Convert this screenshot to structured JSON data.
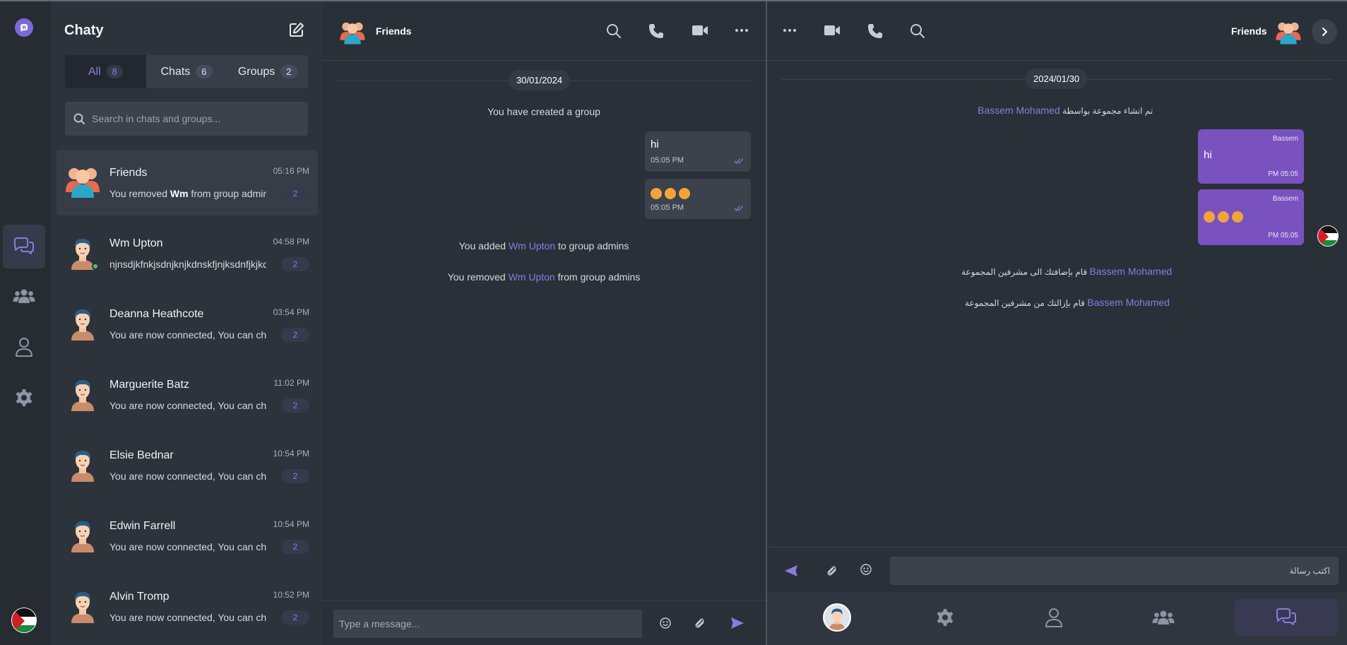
{
  "app": {
    "title": "Chaty",
    "accent": "#8c7ae0",
    "bubble_sent_rtl": "#7a52c0"
  },
  "rail": {
    "items": [
      "chat-bubbles-icon",
      "users-icon",
      "user-icon",
      "gear-icon"
    ]
  },
  "tabs": [
    {
      "label": "All",
      "count": "8"
    },
    {
      "label": "Chats",
      "count": "6"
    },
    {
      "label": "Groups",
      "count": "2"
    }
  ],
  "search": {
    "placeholder": "Search in chats and groups..."
  },
  "chats": [
    {
      "name": "Friends",
      "time": "05:16 PM",
      "preview_pre": "You removed ",
      "preview_bold": "Wm",
      "preview_post": " from group admins",
      "badge": "2"
    },
    {
      "name": "Wm Upton",
      "time": "04:58 PM",
      "preview_pre": "njnsdjkfnkjsdnjknjkdnskfjnjksdnfjkjkdnfjkdn",
      "preview_bold": "",
      "preview_post": "",
      "badge": "2"
    },
    {
      "name": "Deanna Heathcote",
      "time": "03:54 PM",
      "preview_pre": "You are now connected, You can chat now",
      "preview_bold": "",
      "preview_post": "",
      "badge": "2"
    },
    {
      "name": "Marguerite Batz",
      "time": "11:02 PM",
      "preview_pre": "You are now connected, You can chat now",
      "preview_bold": "",
      "preview_post": "",
      "badge": "2"
    },
    {
      "name": "Elsie Bednar",
      "time": "10:54 PM",
      "preview_pre": "You are now connected, You can chat now",
      "preview_bold": "",
      "preview_post": "",
      "badge": "2"
    },
    {
      "name": "Edwin Farrell",
      "time": "10:54 PM",
      "preview_pre": "You are now connected, You can chat now",
      "preview_bold": "",
      "preview_post": "",
      "badge": "2"
    },
    {
      "name": "Alvin Tromp",
      "time": "10:52 PM",
      "preview_pre": "You are now connected, You can chat now",
      "preview_bold": "",
      "preview_post": "",
      "badge": "2"
    }
  ],
  "center": {
    "group_name": "Friends",
    "date": "30/01/2024",
    "created": "You have created a group",
    "messages": [
      {
        "text": "hi",
        "time": "05:05 PM"
      },
      {
        "text": "",
        "time": "05:05 PM"
      }
    ],
    "added": {
      "pre": "You added ",
      "link": "Wm Upton",
      "post": " to group admins"
    },
    "removed": {
      "pre": "You removed ",
      "link": "Wm Upton",
      "post": " from group admins"
    },
    "input_placeholder": "Type a message..."
  },
  "right": {
    "group_name": "Friends",
    "date": "2024/01/30",
    "created": {
      "text": "تم انشاء مجموعة بواسطة",
      "link": "Bassem Mohamed"
    },
    "messages": [
      {
        "sender": "Bassem",
        "text": "hi",
        "time": "PM 05:05"
      },
      {
        "sender": "Bassem",
        "text": "",
        "time": "PM 05:05"
      }
    ],
    "added": {
      "link": "Bassem Mohamed",
      "text": "قام بإضافتك الى مشرفين المجموعة"
    },
    "removed": {
      "link": "Bassem Mohamed",
      "text": "قام بإزالتك من مشرفين المجموعة"
    },
    "input_placeholder": "اكتب رسالة"
  }
}
